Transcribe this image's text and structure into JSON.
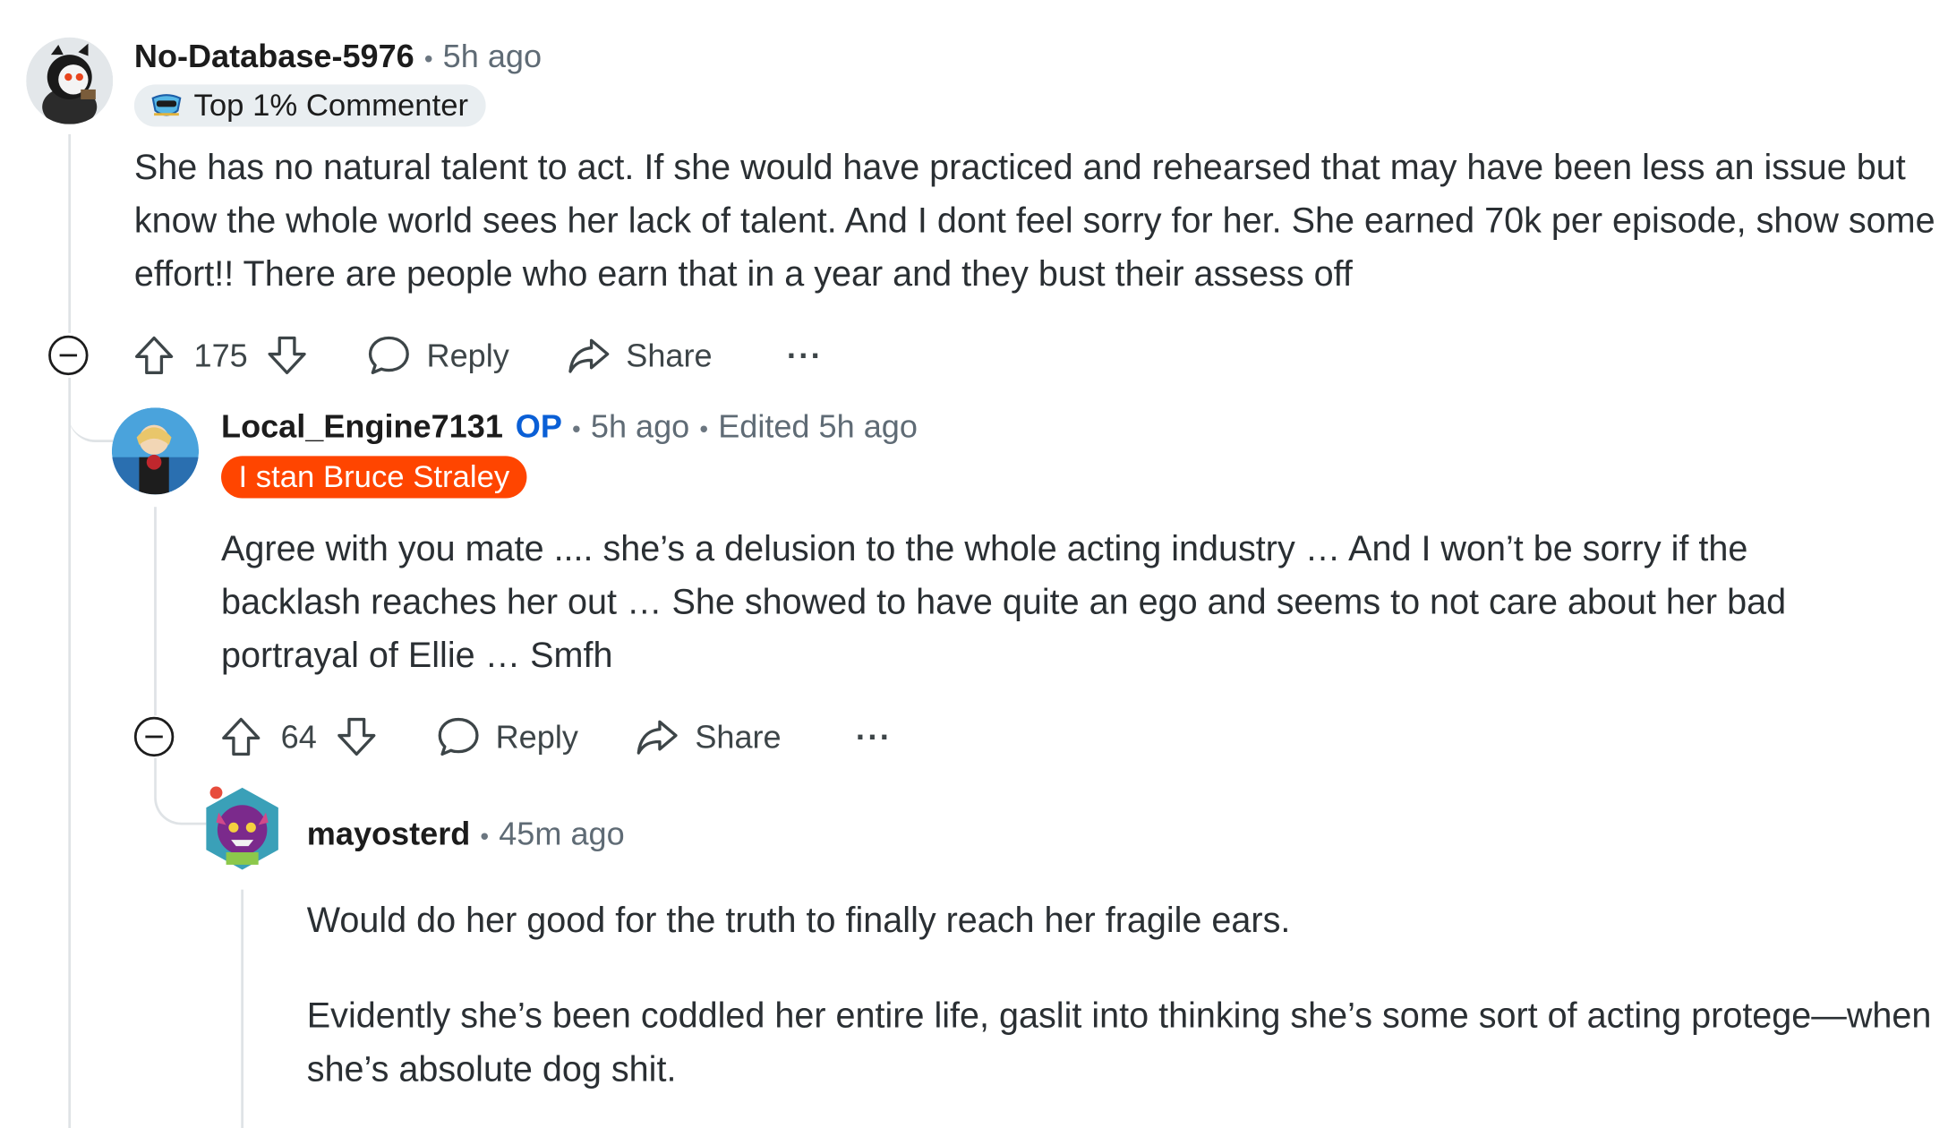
{
  "comments": [
    {
      "author": "No-Database-5976",
      "time": "5h ago",
      "flair": "Top 1% Commenter",
      "flair_icon": "shield-badge-icon",
      "text": "She has no natural talent to act. If she would have practiced and rehearsed that may have been less an issue but know the whole world sees her lack of talent. And I dont feel sorry for her. She earned 70k per episode, show some effort!! There are people who earn that in a year and they bust their assess off",
      "votes": "175",
      "reply_label": "Reply",
      "share_label": "Share",
      "more_label": "···"
    },
    {
      "author": "Local_Engine7131",
      "op_label": "OP",
      "time": "5h ago",
      "edited": "Edited 5h ago",
      "flair": "I stan Bruce Straley",
      "flair_color": "#ff4500",
      "text": "Agree with you mate .... she’s a delusion to the whole acting industry … And I won’t be sorry if the backlash reaches her out … She showed to have quite an ego and seems to not care about her bad portrayal of Ellie … Smfh",
      "votes": "64",
      "reply_label": "Reply",
      "share_label": "Share",
      "more_label": "···"
    },
    {
      "author": "mayosterd",
      "time": "45m ago",
      "text_p1": "Would do her good for the truth to finally reach her fragile ears.",
      "text_p2": "Evidently she’s been coddled her entire life, gaslit into thinking she’s some sort of acting protege—when she’s absolute dog shit."
    }
  ],
  "separator": "•"
}
